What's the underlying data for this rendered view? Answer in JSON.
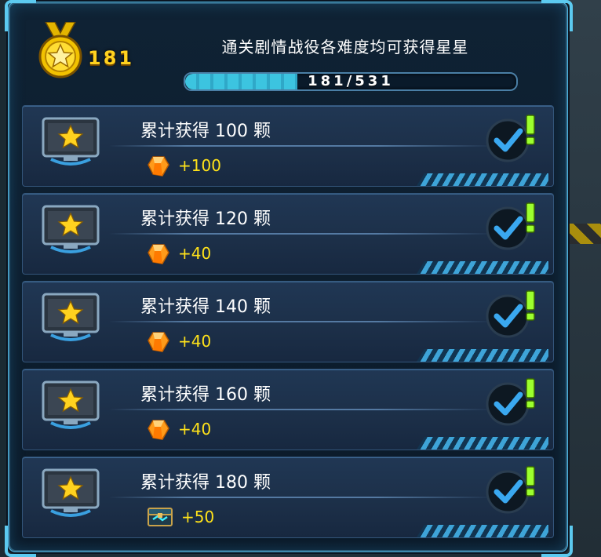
{
  "header": {
    "star_count": "181",
    "title": "通关剧情战役各难度均可获得星星",
    "progress_text": "181/531",
    "progress_fraction": 0.34
  },
  "rewards": [
    {
      "label": "累计获得 100 颗",
      "reward_icon": "crystal-icon",
      "reward_amount": "+100",
      "claimed": true
    },
    {
      "label": "累计获得 120 颗",
      "reward_icon": "crystal-icon",
      "reward_amount": "+40",
      "claimed": true
    },
    {
      "label": "累计获得 140 颗",
      "reward_icon": "crystal-icon",
      "reward_amount": "+40",
      "claimed": true
    },
    {
      "label": "累计获得 160 颗",
      "reward_icon": "crystal-icon",
      "reward_amount": "+40",
      "claimed": true
    },
    {
      "label": "累计获得 180 颗",
      "reward_icon": "chest-icon",
      "reward_amount": "+50",
      "claimed": true
    }
  ],
  "colors": {
    "accent": "#4fb4e0",
    "gold": "#ffd21f",
    "reward_text": "#ffe21a",
    "check_blue": "#3aa8f0",
    "exclaim_green": "#9cff2e"
  }
}
